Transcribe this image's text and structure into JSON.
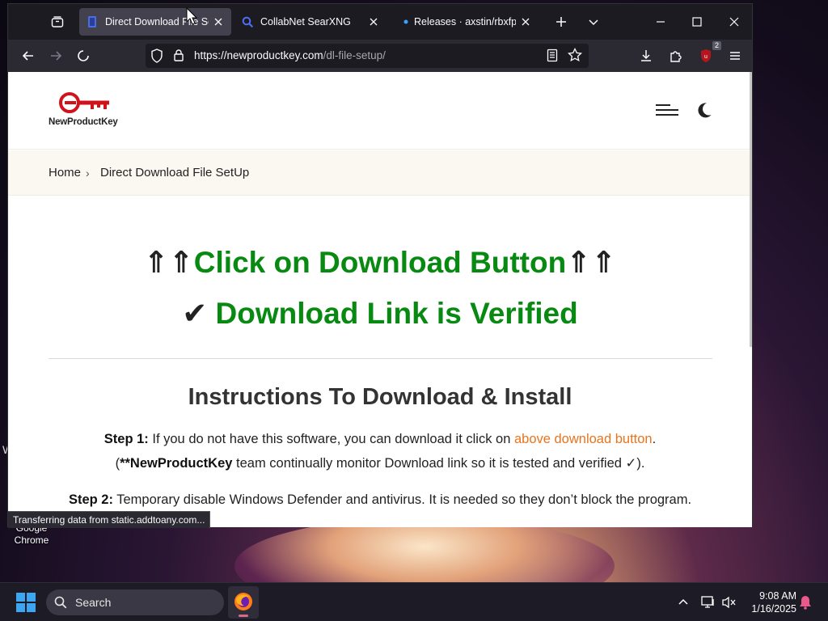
{
  "browser": {
    "tabs": [
      {
        "title": "Direct Download File SetUp",
        "active": true
      },
      {
        "title": "CollabNet SearXNG",
        "active": false
      },
      {
        "title": "Releases · axstin/rbxfpsunlocker",
        "active": false
      }
    ],
    "url_host": "https://newproductkey.com",
    "url_path": "/dl-file-setup/",
    "extension_badge": "2",
    "status_text": "Transferring data from static.addtoany.com..."
  },
  "site": {
    "logo_text": "NewProductKey",
    "breadcrumb": {
      "home": "Home",
      "separator": "›",
      "current": "Direct Download File SetUp"
    },
    "headline1": {
      "arrows_left": "⇑⇑",
      "text": "Click on Download Button",
      "arrows_right": "⇑⇑"
    },
    "headline2": {
      "check": "✔",
      "text": "Download Link is Verified"
    },
    "section_title": "Instructions To Download & Install",
    "step1": {
      "label": "Step 1:",
      "text_a": " If you do not have this software, you can download it click on ",
      "link": "above download button",
      "text_b": ".",
      "line2_a": "(",
      "line2_bold": "**NewProductKey",
      "line2_b": " team continually monitor Download link so it is tested and verified ✓)."
    },
    "step2": {
      "label": "Step 2:",
      "text": " Temporary disable Windows Defender and antivirus. It is needed so they don’t block the program."
    },
    "colors": {
      "headline_green": "#088a12",
      "link_orange": "#e8741c",
      "logo_red": "#d0121b"
    }
  },
  "desktop": {
    "icon_label": "Google Chrome",
    "edge_char": "W"
  },
  "taskbar": {
    "search_placeholder": "Search",
    "time": "9:08 AM",
    "date": "1/16/2025"
  }
}
